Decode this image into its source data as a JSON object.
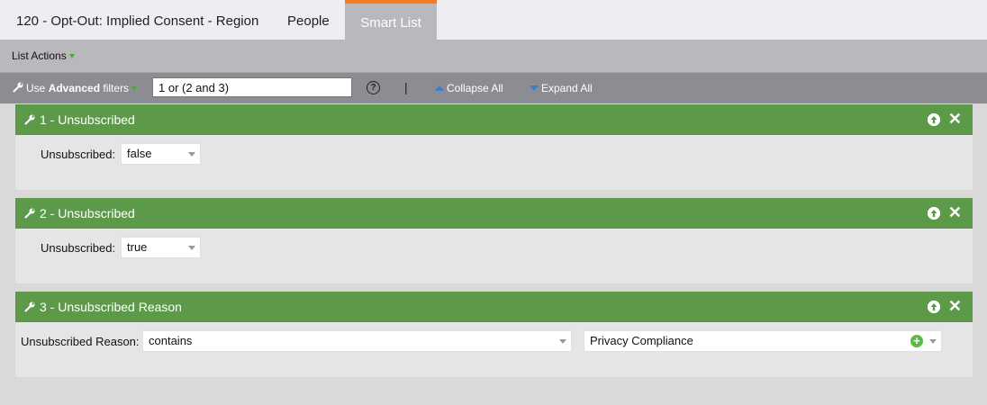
{
  "tabs": {
    "title": "120 - Opt-Out: Implied Consent - Region",
    "people": "People",
    "smart_list": "Smart List",
    "active_accent": "#f47b20"
  },
  "toolbar": {
    "list_actions": "List Actions"
  },
  "logic_bar": {
    "use_prefix": "Use",
    "advanced": "Advanced",
    "filters": "filters",
    "logic_value": "1 or (2 and 3)",
    "help_glyph": "?",
    "separator": "|",
    "collapse_all": "Collapse All",
    "expand_all": "Expand All"
  },
  "filters": [
    {
      "title": "1 - Unsubscribed",
      "field_label": "Unsubscribed:",
      "value": "false"
    },
    {
      "title": "2 - Unsubscribed",
      "field_label": "Unsubscribed:",
      "value": "true"
    },
    {
      "title": "3 - Unsubscribed Reason",
      "field_label": "Unsubscribed Reason:",
      "operator": "contains",
      "value": "Privacy Compliance"
    }
  ],
  "colors": {
    "panel_header": "#5c9a4a",
    "panel_body": "#e5e5e5",
    "logic_bar": "#8c8d92"
  }
}
